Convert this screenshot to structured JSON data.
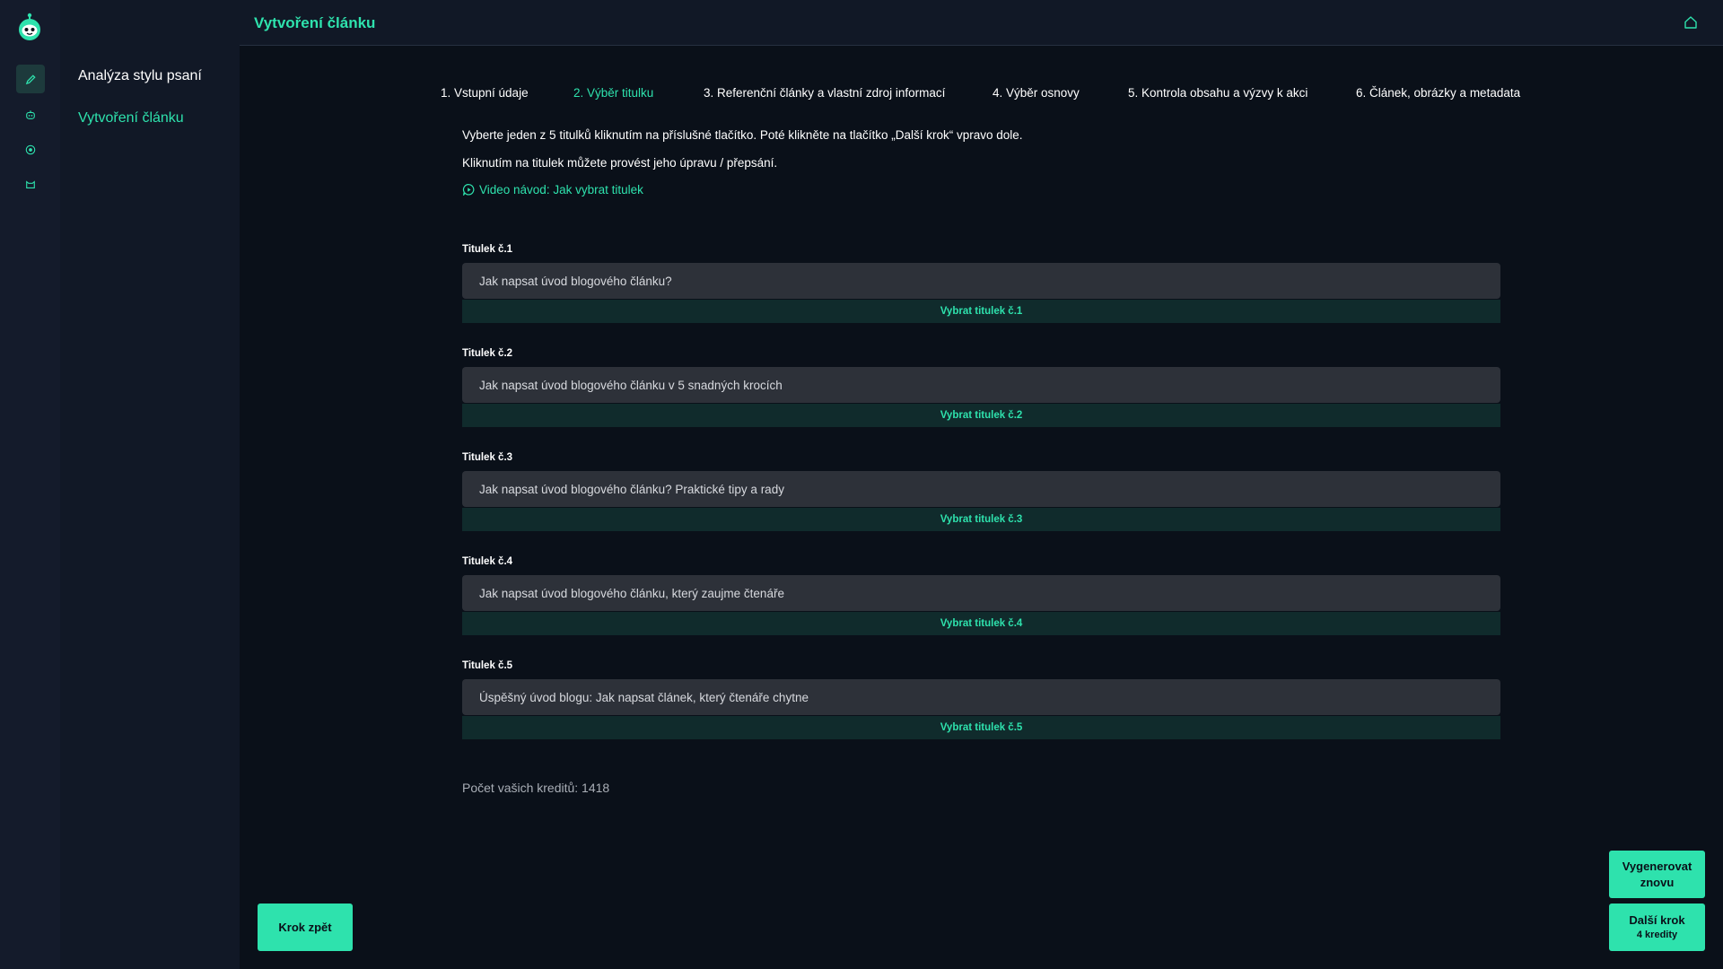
{
  "app": {
    "page_title": "Vytvoření článku"
  },
  "rail": {
    "icons": [
      "pencil-icon",
      "robot-icon",
      "target-icon",
      "cat-icon"
    ],
    "accent": "#2ee2ad"
  },
  "subnav": {
    "items": [
      {
        "label": "Analýza stylu psaní"
      },
      {
        "label": "Vytvoření článku"
      }
    ]
  },
  "steps": [
    {
      "label": "1. Vstupní údaje"
    },
    {
      "label": "2. Výběr titulku"
    },
    {
      "label": "3. Referenční články a vlastní zdroj informací"
    },
    {
      "label": "4. Výběr osnovy"
    },
    {
      "label": "5. Kontrola obsahu a výzvy k akci"
    },
    {
      "label": "6. Článek, obrázky a metadata"
    }
  ],
  "instructions": {
    "line1": "Vyberte jeden z 5 titulků kliknutím na příslušné tlačítko. Poté klikněte na tlačítko „Další krok“ vpravo dole.",
    "line2": "Kliknutím na titulek můžete provést jeho úpravu / přepsání.",
    "video_link": "Video návod: Jak vybrat titulek"
  },
  "titles": [
    {
      "label": "Titulek č.1",
      "value": "Jak napsat úvod blogového článku?",
      "button": "Vybrat titulek č.1"
    },
    {
      "label": "Titulek č.2",
      "value": "Jak napsat úvod blogového článku v 5 snadných krocích",
      "button": "Vybrat titulek č.2"
    },
    {
      "label": "Titulek č.3",
      "value": "Jak napsat úvod blogového článku? Praktické tipy a rady",
      "button": "Vybrat titulek č.3"
    },
    {
      "label": "Titulek č.4",
      "value": "Jak napsat úvod blogového článku, který zaujme čtenáře",
      "button": "Vybrat titulek č.4"
    },
    {
      "label": "Titulek č.5",
      "value": "Úspěšný úvod blogu: Jak napsat článek, který čtenáře chytne",
      "button": "Vybrat titulek č.5"
    }
  ],
  "credits_text": "Počet vašich kreditů: 1418",
  "buttons": {
    "back": "Krok zpět",
    "regenerate": "Vygenerovat znovu",
    "next": "Další krok",
    "next_cost": "4 kredity"
  }
}
